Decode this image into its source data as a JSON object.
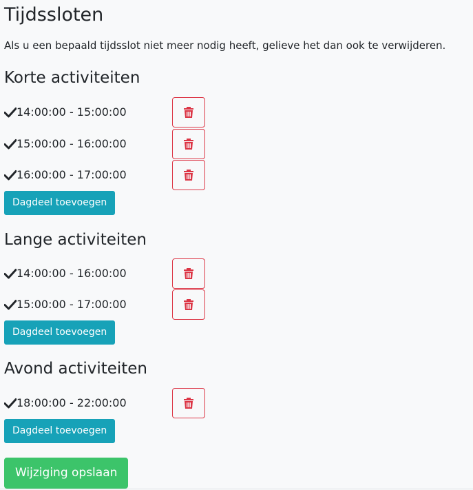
{
  "page": {
    "title": "Tijdssloten",
    "intro": "Als u een bepaald tijdsslot niet meer nodig heeft, gelieve het dan ook te verwijderen."
  },
  "icons": {
    "check": "check-icon",
    "delete": "trash-icon"
  },
  "colors": {
    "danger": "#dc3545",
    "info": "#17a2b8",
    "success": "#3cc46a",
    "background": "#f8f9fa"
  },
  "sections": [
    {
      "title": "Korte activiteiten",
      "slots": [
        "14:00:00 - 15:00:00",
        "15:00:00 - 16:00:00",
        "16:00:00 - 17:00:00"
      ],
      "add_label": "Dagdeel toevoegen"
    },
    {
      "title": "Lange activiteiten",
      "slots": [
        "14:00:00 - 16:00:00",
        "15:00:00 - 17:00:00"
      ],
      "add_label": "Dagdeel toevoegen"
    },
    {
      "title": "Avond activiteiten",
      "slots": [
        "18:00:00 - 22:00:00"
      ],
      "add_label": "Dagdeel toevoegen"
    }
  ],
  "save_label": "Wijziging opslaan"
}
